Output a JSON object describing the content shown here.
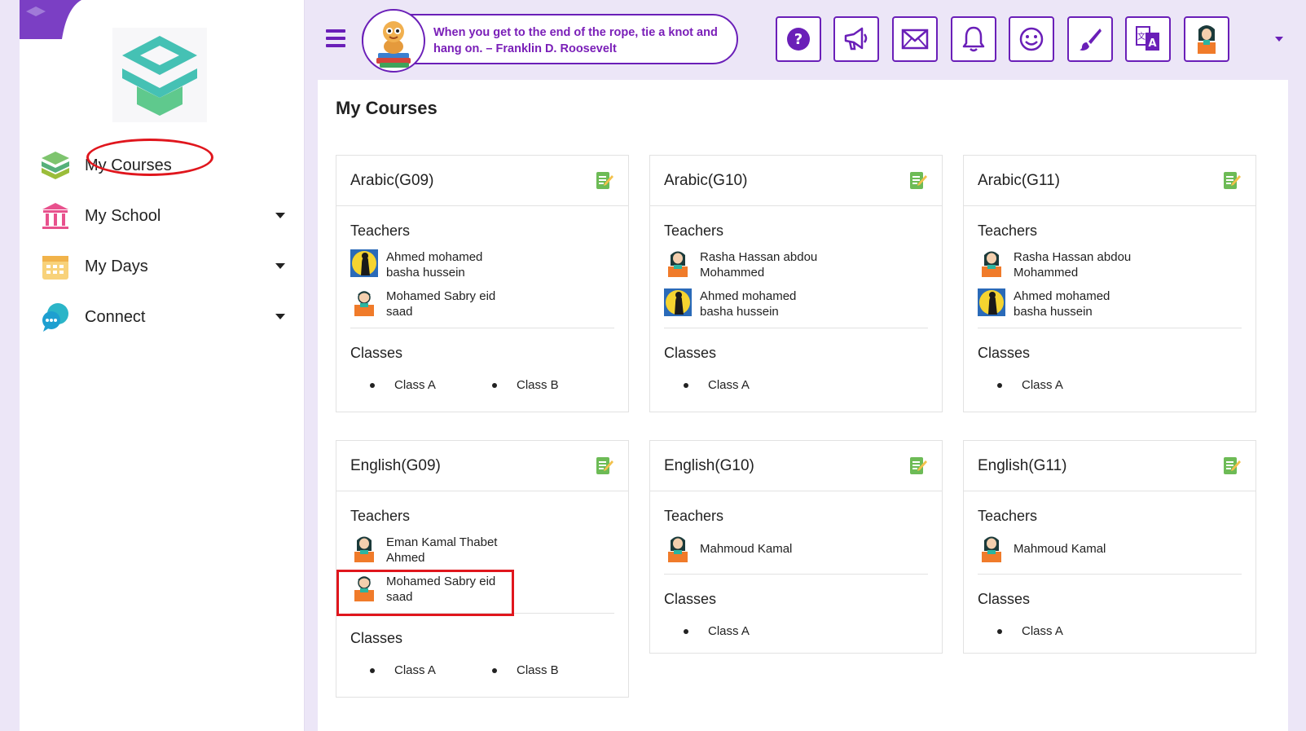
{
  "sidebar": {
    "items": [
      {
        "label": "My Courses",
        "icon": "books-icon"
      },
      {
        "label": "My School",
        "icon": "school-building-icon"
      },
      {
        "label": "My Days",
        "icon": "calendar-icon"
      },
      {
        "label": "Connect",
        "icon": "chat-bubbles-icon"
      }
    ]
  },
  "header": {
    "quote": "When you get to the end of the rope, tie a knot and hang on. – Franklin D. Roosevelt",
    "buttons": [
      "help-icon",
      "megaphone-icon",
      "mail-icon",
      "bell-icon",
      "smiley-icon",
      "paintbrush-icon",
      "translate-icon",
      "user-avatar-icon"
    ]
  },
  "main": {
    "title": "My Courses",
    "teachers_label": "Teachers",
    "classes_label": "Classes",
    "courses": [
      {
        "title": "Arabic(G09)",
        "teachers": [
          {
            "name": "Ahmed mohamed basha hussein",
            "avatar": "silhouette"
          },
          {
            "name": "Mohamed Sabry eid saad",
            "avatar": "male"
          }
        ],
        "classes": [
          "Class A",
          "Class B"
        ]
      },
      {
        "title": "Arabic(G10)",
        "teachers": [
          {
            "name": "Rasha Hassan abdou Mohammed",
            "avatar": "female"
          },
          {
            "name": "Ahmed mohamed basha hussein",
            "avatar": "silhouette"
          }
        ],
        "classes": [
          "Class A"
        ]
      },
      {
        "title": "Arabic(G11)",
        "teachers": [
          {
            "name": "Rasha Hassan abdou Mohammed",
            "avatar": "female"
          },
          {
            "name": "Ahmed mohamed basha hussein",
            "avatar": "silhouette"
          }
        ],
        "classes": [
          "Class A"
        ]
      },
      {
        "title": "English(G09)",
        "teachers": [
          {
            "name": "Eman Kamal Thabet Ahmed",
            "avatar": "female"
          },
          {
            "name": "Mohamed Sabry eid saad",
            "avatar": "male"
          }
        ],
        "classes": [
          "Class A",
          "Class B"
        ]
      },
      {
        "title": "English(G10)",
        "teachers": [
          {
            "name": "Mahmoud Kamal",
            "avatar": "female"
          }
        ],
        "classes": [
          "Class A"
        ]
      },
      {
        "title": "English(G11)",
        "teachers": [
          {
            "name": "Mahmoud Kamal",
            "avatar": "female"
          }
        ],
        "classes": [
          "Class A"
        ]
      }
    ]
  },
  "colors": {
    "accent": "#6a1fb8",
    "annotation": "#e0161d",
    "background": "#ece6f7"
  }
}
